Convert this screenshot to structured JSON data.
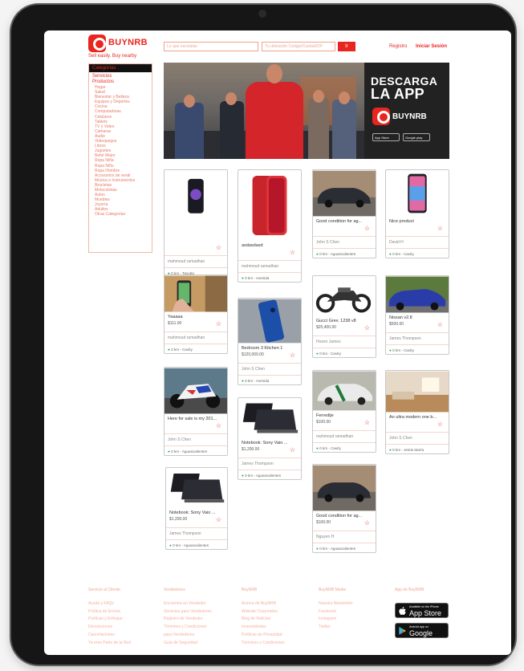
{
  "header": {
    "brand": "BUYNRB",
    "tagline": "Sell easily. Buy nearby",
    "search_placeholder": "Lo que necesitas",
    "location_placeholder": "Tu ubicación Código/Ciudad/ZIP",
    "search_button": "Ir",
    "register": "Registro",
    "login": "Iniciar Sesión"
  },
  "sidebar": {
    "title": "Categorías",
    "top_items": [
      "Servicios",
      "Productos"
    ],
    "items": [
      "Hogar",
      "Salud",
      "Bienestar y Belleza",
      "Equipos y Deportes",
      "Cocina",
      "Computadoras",
      "Celulares",
      "Tablets",
      "TV y Video",
      "Cámaras",
      "Audio",
      "Videojuegos",
      "Libros",
      "Juguetes",
      "Bebé Mejor",
      "Ropa Niña",
      "Ropa Niño",
      "Ropa Hombre",
      "Accesorios de vestir",
      "Música e Instrumentos",
      "Bicicletas",
      "Motocicletas",
      "Autos",
      "Muebles",
      "Joyería",
      "Adultos",
      "Otras Categorías"
    ]
  },
  "banner": {
    "title_line1": "DESCARGA",
    "title_line2": "LA APP",
    "brand": "BUYNRB",
    "app_store": "App Store",
    "google_play": "Google play"
  },
  "listings": [
    {
      "title": "",
      "price": "",
      "user": "mahmoud ramadhan",
      "location": "0 km - Tacuba",
      "image": "phone-dark-icon"
    },
    {
      "title": "asdasdasd",
      "price": "",
      "user": "mahmoud ramadhan",
      "location": "0 km - Avenida",
      "image": "phone-red-icon"
    },
    {
      "title": "Good condition for ag...",
      "price": "",
      "user": "John S Chen",
      "location": "0 km - Aguascalientes",
      "image": "car-icon"
    },
    {
      "title": "Nice product",
      "price": "",
      "user": "David H",
      "location": "0 km - Cavity",
      "image": "phone-color-icon"
    },
    {
      "title": "Yaaaaa",
      "price": "$111.00",
      "user": "mahmoud ramadhan",
      "location": "0 km - Cavity",
      "image": "phone-hand-icon"
    },
    {
      "title": "Bedroom 3 Kitchen 1",
      "price": "$120,000.00",
      "user": "John S Chen",
      "location": "0 km - Avenida",
      "image": "phone-blue-icon"
    },
    {
      "title": "Gucci Grev. 1238 v8",
      "price": "$25,400.00",
      "user": "Hozen James",
      "location": "0 km - Cavity",
      "image": "motorcycle-icon"
    },
    {
      "title": "Nissan v2.8",
      "price": "$500.00",
      "user": "James Thompson",
      "location": "0 km - Cavity",
      "image": "car-blue-icon"
    },
    {
      "title": "Here for sale is my 201...",
      "price": "",
      "user": "John S Chen",
      "location": "0 km - Aguascalientes",
      "image": "sportbike-icon"
    },
    {
      "title": "Notebook: Sony Vaio ...",
      "price": "$1,200.00",
      "user": "James Thompson",
      "location": "0 km - Aguascalientes",
      "image": "laptop-icon"
    },
    {
      "title": "Ferredije",
      "price": "$100.00",
      "user": "mahmoud ramadhan",
      "location": "0 km - Cavity",
      "image": "sportscar-icon"
    },
    {
      "title": "An ultra modern one b...",
      "price": "",
      "user": "John S Chen",
      "location": "0 km - Jesús María",
      "image": "room-icon"
    },
    {
      "title": "Notebook: Sony Vaio ...",
      "price": "$1,200.00",
      "user": "James Thompson",
      "location": "0 km - Aguascalientes",
      "image": "laptop-icon"
    },
    {
      "title": "Good condition for ag...",
      "price": "$100.00",
      "user": "Nguyen H",
      "location": "0 km - Aguascalientes",
      "image": "car-icon"
    }
  ],
  "footer": {
    "columns": [
      {
        "head": "Servicio al Cliente",
        "links": [
          "Ayuda y FAQs",
          "Política de Envíos",
          "Políticas y Enfoque",
          "Devoluciones",
          "Cancelaciones",
          "Ya eres Parte de la Red"
        ]
      },
      {
        "head": "Vendedores",
        "links": [
          "Encuentra un Vendedor",
          "Servicios para Vendedores",
          "Registro de Vendedor",
          "Términos y Condiciones",
          "para Vendedores",
          "Guía de Seguridad"
        ]
      },
      {
        "head": "BuyNRB",
        "links": [
          "Acerca de BuyNRB",
          "Website Corporativo",
          "Blog de Noticias",
          "Inversionistas",
          "Políticas de Privacidad",
          "Términos y Condiciones"
        ]
      },
      {
        "head": "BuyNRB Media",
        "links": [
          "Nuestro Newsletter",
          "Facebook",
          "Instagram",
          "Twitter"
        ]
      },
      {
        "head": "App de BuyNRB",
        "links": []
      }
    ],
    "app_store_small": "Available on the iPhone",
    "app_store": "App Store",
    "google_play_small": "Android app on",
    "google_play": "Google play"
  },
  "colors": {
    "accent": "#e8261f",
    "bezel": "#161616"
  }
}
